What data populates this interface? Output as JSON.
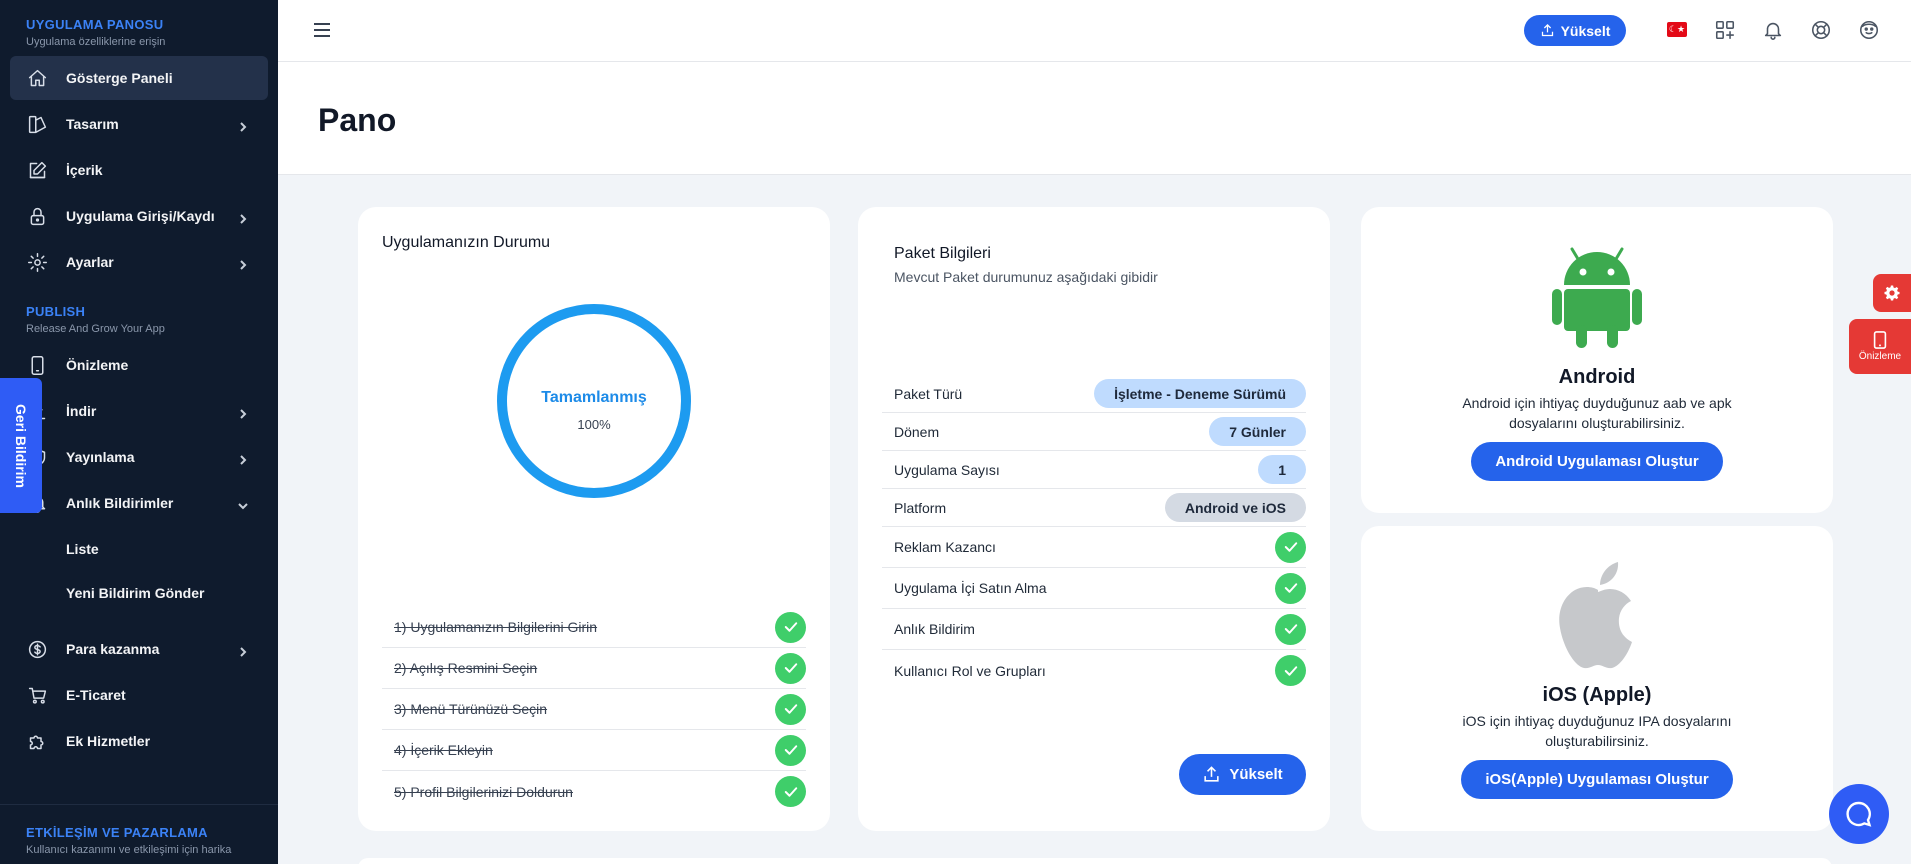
{
  "sidebar": {
    "section1": {
      "title": "UYGULAMA PANOSU",
      "subtitle": "Uygulama özelliklerine erişin"
    },
    "items_main": [
      {
        "label": "Gösterge Paneli"
      },
      {
        "label": "Tasarım"
      },
      {
        "label": "İçerik"
      },
      {
        "label": "Uygulama Girişi/Kaydı"
      },
      {
        "label": "Ayarlar"
      }
    ],
    "section2": {
      "title": "PUBLISH",
      "subtitle": "Release And Grow Your App"
    },
    "items_publish": [
      {
        "label": "Önizleme"
      },
      {
        "label": "İndir"
      },
      {
        "label": "Yayınlama"
      },
      {
        "label": "Anlık Bildirimler"
      }
    ],
    "sub_items": [
      {
        "label": "Liste"
      },
      {
        "label": "Yeni Bildirim Gönder"
      }
    ],
    "items_more": [
      {
        "label": "Para kazanma"
      },
      {
        "label": "E-Ticaret"
      },
      {
        "label": "Ek Hizmetler"
      }
    ],
    "section3": {
      "title": "ETKİLEŞİM VE PAZARLAMA",
      "subtitle": "Kullanıcı kazanımı ve etkileşimi için harika"
    }
  },
  "feedback": {
    "label": "Geri Bildirim"
  },
  "topbar": {
    "upgrade_label": "Yükselt"
  },
  "page": {
    "title": "Pano"
  },
  "status_card": {
    "title": "Uygulamanızın Durumu",
    "ring_label": "Tamamlanmış",
    "ring_percent_text": "100%",
    "progress": 100,
    "steps": [
      "1) Uygulamanızın Bilgilerini Girin",
      "2) Açılış Resmini Seçin",
      "3) Menü Türünüzü Seçin",
      "4) İçerik Ekleyin",
      "5) Profil Bilgilerinizi Doldurun"
    ]
  },
  "package_card": {
    "title": "Paket Bilgileri",
    "subtitle": "Mevcut Paket durumunuz aşağıdaki gibidir",
    "rows_values": [
      {
        "key": "Paket Türü",
        "value": "İşletme - Deneme Sürümü"
      },
      {
        "key": "Dönem",
        "value": "7 Günler"
      },
      {
        "key": "Uygulama Sayısı",
        "value": "1"
      },
      {
        "key": "Platform",
        "value": "Android ve iOS"
      }
    ],
    "rows_checks": [
      "Reklam Kazancı",
      "Uygulama İçi Satın Alma",
      "Anlık Bildirim",
      "Kullanıcı Rol ve Grupları"
    ],
    "upgrade_label": "Yükselt"
  },
  "android_card": {
    "name": "Android",
    "description": "Android için ihtiyaç duyduğunuz aab ve apk dosyalarını oluşturabilirsiniz.",
    "button": "Android Uygulaması Oluştur"
  },
  "ios_card": {
    "name": "iOS (Apple)",
    "description": "iOS için ihtiyaç duyduğunuz IPA dosyalarını oluşturabilirsiniz.",
    "button": "iOS(Apple) Uygulaması Oluştur"
  },
  "side_panel": {
    "preview_label": "Önizleme"
  },
  "colors": {
    "accent": "#2563eb",
    "sidebar_bg": "#0f1b2d",
    "success": "#3fce6a",
    "ring": "#1d9bf0",
    "android": "#3daa4f",
    "danger": "#e53935"
  }
}
